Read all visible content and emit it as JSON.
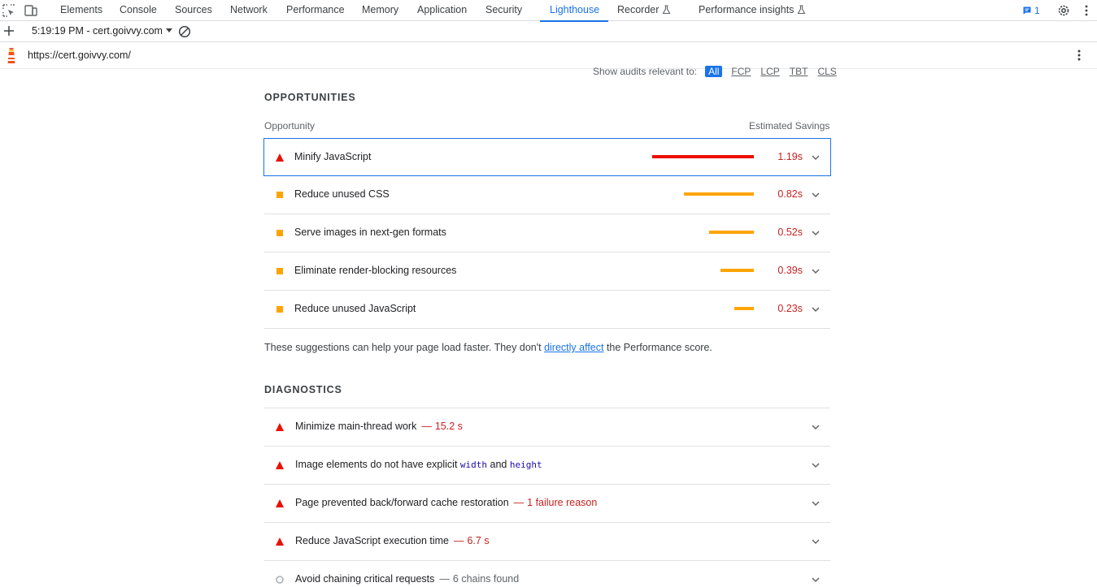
{
  "devtools": {
    "tabs": [
      {
        "label": "Elements"
      },
      {
        "label": "Console"
      },
      {
        "label": "Sources"
      },
      {
        "label": "Network"
      },
      {
        "label": "Performance"
      },
      {
        "label": "Memory"
      },
      {
        "label": "Application"
      },
      {
        "label": "Security"
      },
      {
        "label": "Lighthouse",
        "active": true
      },
      {
        "label": "Recorder",
        "experimental": true
      },
      {
        "label": "Performance insights",
        "experimental": true
      }
    ],
    "issues_count": "1",
    "accent_color": "#1a73e8"
  },
  "toolbar": {
    "report_label": "5:19:19 PM - cert.goivvy.com"
  },
  "urlbar": {
    "url": "https://cert.goivvy.com/"
  },
  "filter": {
    "label": "Show audits relevant to:",
    "chips": [
      "All",
      "FCP",
      "LCP",
      "TBT",
      "CLS"
    ],
    "active": "All"
  },
  "opportunities": {
    "heading": "OPPORTUNITIES",
    "col_opportunity": "Opportunity",
    "col_savings": "Estimated Savings",
    "items": [
      {
        "title": "Minify JavaScript",
        "savings": "1.19s",
        "severity": "fail",
        "bar_fraction": 1.0,
        "color": "#eb0f00"
      },
      {
        "title": "Reduce unused CSS",
        "savings": "0.82s",
        "severity": "average",
        "bar_fraction": 0.69,
        "color": "#ffa400"
      },
      {
        "title": "Serve images in next-gen formats",
        "savings": "0.52s",
        "severity": "average",
        "bar_fraction": 0.44,
        "color": "#ffa400"
      },
      {
        "title": "Eliminate render-blocking resources",
        "savings": "0.39s",
        "severity": "average",
        "bar_fraction": 0.33,
        "color": "#ffa400"
      },
      {
        "title": "Reduce unused JavaScript",
        "savings": "0.23s",
        "severity": "average",
        "bar_fraction": 0.19,
        "color": "#ffa400"
      }
    ],
    "note_before": "These suggestions can help your page load faster. They don't ",
    "note_link": "directly affect",
    "note_after": " the Performance score."
  },
  "diagnostics": {
    "heading": "DIAGNOSTICS",
    "items": [
      {
        "title": "Minimize main-thread work",
        "detail": "15.2 s",
        "severity": "fail"
      },
      {
        "title_before": "Image elements do not have explicit ",
        "code1": "width",
        "title_mid": " and ",
        "code2": "height",
        "severity": "fail"
      },
      {
        "title": "Page prevented back/forward cache restoration",
        "detail": "1 failure reason",
        "severity": "fail"
      },
      {
        "title": "Reduce JavaScript execution time",
        "detail": "6.7 s",
        "severity": "fail"
      },
      {
        "title": "Avoid chaining critical requests",
        "detail": "6 chains found",
        "severity": "info"
      }
    ]
  },
  "colors": {
    "fail": "#eb0f00",
    "average": "#ffa400",
    "info": "#9aa0a6"
  }
}
